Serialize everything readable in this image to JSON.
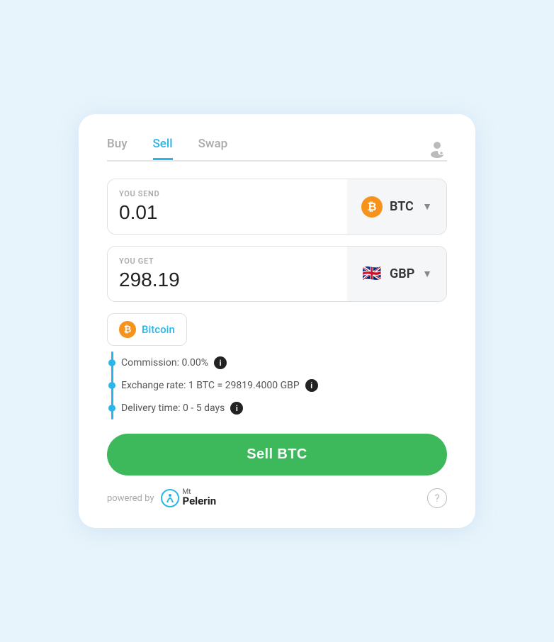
{
  "tabs": [
    {
      "label": "Buy",
      "active": false
    },
    {
      "label": "Sell",
      "active": true
    },
    {
      "label": "Swap",
      "active": false
    }
  ],
  "send": {
    "label": "YOU SEND",
    "value": "0.01",
    "currency": "BTC"
  },
  "receive": {
    "label": "YOU GET",
    "value": "298.19",
    "currency": "GBP"
  },
  "suggestion": {
    "label": "Bitcoin"
  },
  "info": {
    "commission": "Commission: 0.00%",
    "exchange_rate": "Exchange rate: 1 BTC = 29819.4000 GBP",
    "delivery": "Delivery time: 0 - 5 days"
  },
  "sell_button": "Sell BTC",
  "footer": {
    "powered_by": "powered by",
    "brand": "Mt",
    "brand_name": "Pelerin"
  },
  "colors": {
    "active_tab": "#29b6e8",
    "sell_btn": "#3db85a",
    "dot": "#29b6e8"
  }
}
